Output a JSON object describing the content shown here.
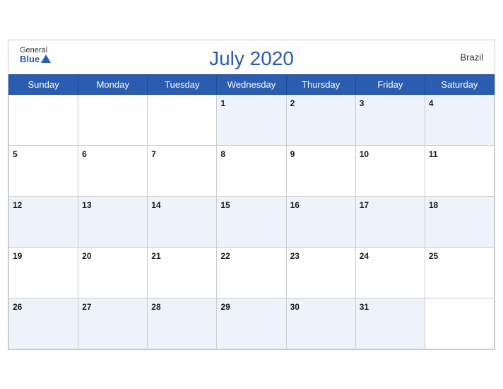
{
  "calendar": {
    "title": "July 2020",
    "country": "Brazil",
    "logo": {
      "general": "General",
      "blue": "Blue"
    },
    "days_of_week": [
      "Sunday",
      "Monday",
      "Tuesday",
      "Wednesday",
      "Thursday",
      "Friday",
      "Saturday"
    ],
    "weeks": [
      [
        null,
        null,
        null,
        1,
        2,
        3,
        4
      ],
      [
        5,
        6,
        7,
        8,
        9,
        10,
        11
      ],
      [
        12,
        13,
        14,
        15,
        16,
        17,
        18
      ],
      [
        19,
        20,
        21,
        22,
        23,
        24,
        25
      ],
      [
        26,
        27,
        28,
        29,
        30,
        31,
        null
      ]
    ]
  }
}
